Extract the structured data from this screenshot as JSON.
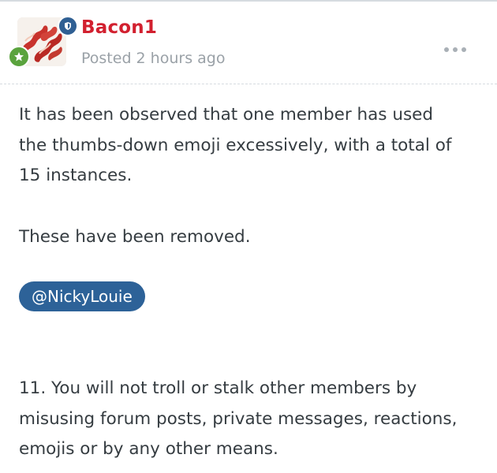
{
  "post": {
    "author": "Bacon1",
    "posted": "Posted 2 hours ago",
    "body": {
      "paragraph_1": "It has been observed that one member has used\nthe thumbs-down emoji excessively, with a total of\n15 instances.",
      "paragraph_2": "These have been removed.",
      "mention": "@NickyLouie",
      "paragraph_3": "11. You will not troll or stalk other members by\nmisusing forum posts, private messages, reactions,\nemojis or by any other means."
    }
  },
  "icons": {
    "moderator_badge": "shield-icon",
    "rank_badge": "star-icon",
    "menu": "more-options-icon"
  },
  "colors": {
    "username": "#d2202f",
    "moderator_badge": "#2f5f93",
    "rank_badge": "#5aa33d",
    "mention_pill": "#2d6298",
    "meta_text": "#9aa1a7",
    "body_text": "#353c41"
  }
}
